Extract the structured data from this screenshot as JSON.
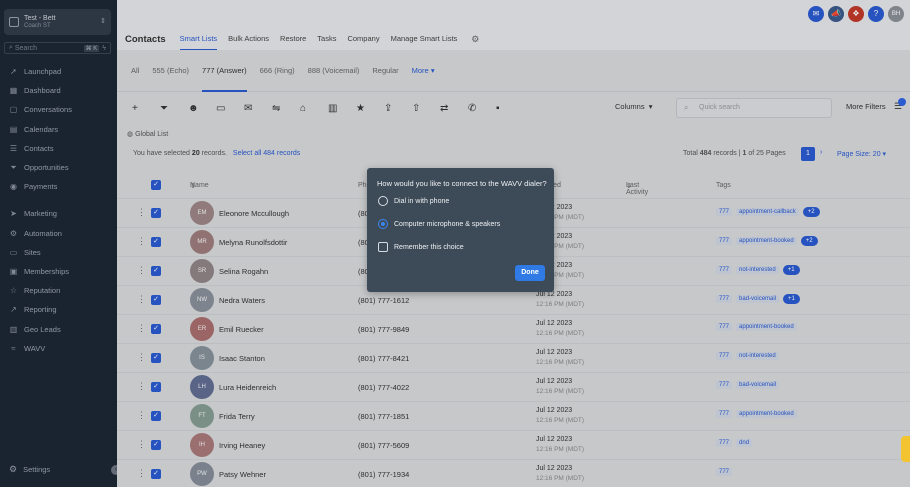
{
  "sidebar": {
    "location_name": "Test - Bett",
    "location_sub": "Coach ST",
    "search_placeholder": "Search",
    "search_shortcut": "⌘ K",
    "items": [
      {
        "label": "Launchpad",
        "icon": "rocket-icon",
        "glyph": "➚"
      },
      {
        "label": "Dashboard",
        "icon": "dashboard-icon",
        "glyph": "▦"
      },
      {
        "label": "Conversations",
        "icon": "chat-icon",
        "glyph": "▢"
      },
      {
        "label": "Calendars",
        "icon": "calendar-icon",
        "glyph": "▤"
      },
      {
        "label": "Contacts",
        "icon": "contacts-icon",
        "glyph": "☰"
      },
      {
        "label": "Opportunities",
        "icon": "funnel-icon",
        "glyph": "⏷"
      },
      {
        "label": "Payments",
        "icon": "payments-icon",
        "glyph": "◉"
      }
    ],
    "items2": [
      {
        "label": "Marketing",
        "icon": "send-icon",
        "glyph": "➤"
      },
      {
        "label": "Automation",
        "icon": "automation-icon",
        "glyph": "⚙"
      },
      {
        "label": "Sites",
        "icon": "sites-icon",
        "glyph": "▭"
      },
      {
        "label": "Memberships",
        "icon": "memberships-icon",
        "glyph": "▣"
      },
      {
        "label": "Reputation",
        "icon": "star-icon",
        "glyph": "☆"
      },
      {
        "label": "Reporting",
        "icon": "reporting-icon",
        "glyph": "↗"
      },
      {
        "label": "Geo Leads",
        "icon": "geo-leads-icon",
        "glyph": "▥"
      },
      {
        "label": "WAVV",
        "icon": "wavv-icon",
        "glyph": "≈"
      }
    ],
    "settings_label": "Settings"
  },
  "topbar": {
    "avatar_initials": "BH",
    "icons": [
      {
        "name": "message-icon",
        "glyph": "✉",
        "color": "#2a5bd0"
      },
      {
        "name": "megaphone-icon",
        "glyph": "📣",
        "color": "#3a5a8c"
      },
      {
        "name": "gift-icon",
        "glyph": "❖",
        "color": "#c0392b"
      },
      {
        "name": "help-icon",
        "glyph": "?",
        "color": "#2a5bd0"
      },
      {
        "name": "avatar-icon",
        "glyph": "BH",
        "color": "#8a8f96"
      }
    ]
  },
  "subnav": {
    "title": "Contacts",
    "items": [
      "Smart Lists",
      "Bulk Actions",
      "Restore",
      "Tasks",
      "Company",
      "Manage Smart Lists"
    ],
    "active": "Smart Lists"
  },
  "tabs": {
    "items": [
      "All",
      "555 (Echo)",
      "777 (Answer)",
      "666 (Ring)",
      "888 (Voicemail)",
      "Regular"
    ],
    "active": "777 (Answer)",
    "more_label": "More"
  },
  "toolbar": {
    "icons": [
      {
        "name": "add-icon",
        "glyph": "+"
      },
      {
        "name": "filter-icon",
        "glyph": "⏷"
      },
      {
        "name": "robot-icon",
        "glyph": "☻"
      },
      {
        "name": "sms-icon",
        "glyph": "▭"
      },
      {
        "name": "email-icon",
        "glyph": "✉"
      },
      {
        "name": "call-merge-icon",
        "glyph": "⇋"
      },
      {
        "name": "tag-add-icon",
        "glyph": "⌂"
      },
      {
        "name": "delete-icon",
        "glyph": "▥"
      },
      {
        "name": "star-icon",
        "glyph": "★"
      },
      {
        "name": "upload-icon",
        "glyph": "⇪"
      },
      {
        "name": "export-icon",
        "glyph": "⇧"
      },
      {
        "name": "dialer-icon",
        "glyph": "⇄"
      },
      {
        "name": "phone-icon",
        "glyph": "✆"
      },
      {
        "name": "message-square-icon",
        "glyph": "▪"
      }
    ],
    "columns_label": "Columns",
    "search_placeholder": "Quick search",
    "more_filters_label": "More Filters"
  },
  "list_name": "Global List",
  "selection": {
    "selected_prefix": "You have selected",
    "selected_count": "20",
    "selected_suffix": "records.",
    "select_all": "Select all 484 records",
    "total_prefix": "Total",
    "total_count": "484",
    "total_suffix": "records |",
    "page_range": "1",
    "page_of": "of 25 Pages",
    "current_page": "1",
    "page_size": "Page Size: 20"
  },
  "table": {
    "headers": {
      "name": "Name",
      "phone": "Phone",
      "created": "Created",
      "last_activity": "Last Activity",
      "tags": "Tags"
    },
    "rows": [
      {
        "initials": "EM",
        "name": "Eleonore Mccullough",
        "phone": "(801) 777-",
        "date": "Jul 12 2023",
        "time": "12:16 PM (MDT)",
        "color": "#8a6a6a",
        "tags": [
          "777",
          "appointment-callback"
        ],
        "pill": "+2"
      },
      {
        "initials": "MR",
        "name": "Melyna Runolfsdottir",
        "phone": "(801) 777-",
        "date": "Jul 12 2023",
        "time": "12:16 PM (MDT)",
        "color": "#8b5e5e",
        "tags": [
          "777",
          "appointment-booked"
        ],
        "pill": "+2"
      },
      {
        "initials": "SR",
        "name": "Selina Rogahn",
        "phone": "(801) 777-",
        "date": "Jul 12 2023",
        "time": "12:16 PM (MDT)",
        "color": "#7a6a6a",
        "tags": [
          "777",
          "not-interested"
        ],
        "pill": "+1"
      },
      {
        "initials": "NW",
        "name": "Nedra Waters",
        "phone": "(801) 777-1612",
        "date": "Jul 12 2023",
        "time": "12:16 PM (MDT)",
        "color": "#6f7884",
        "tags": [
          "777",
          "bad-voicemail"
        ],
        "pill": "+1"
      },
      {
        "initials": "ER",
        "name": "Emil Ruecker",
        "phone": "(801) 777-9849",
        "date": "Jul 12 2023",
        "time": "12:16 PM (MDT)",
        "color": "#9a4a4a",
        "tags": [
          "777",
          "appointment-booked"
        ],
        "pill": ""
      },
      {
        "initials": "IS",
        "name": "Isaac Stanton",
        "phone": "(801) 777-8421",
        "date": "Jul 12 2023",
        "time": "12:16 PM (MDT)",
        "color": "#6b7a86",
        "tags": [
          "777",
          "not-interested"
        ],
        "pill": ""
      },
      {
        "initials": "LH",
        "name": "Lura Heidenreich",
        "phone": "(801) 777-4022",
        "date": "Jul 12 2023",
        "time": "12:16 PM (MDT)",
        "color": "#3a4a7a",
        "tags": [
          "777",
          "bad-voicemail"
        ],
        "pill": ""
      },
      {
        "initials": "FT",
        "name": "Frida Terry",
        "phone": "(801) 777-1851",
        "date": "Jul 12 2023",
        "time": "12:16 PM (MDT)",
        "color": "#6a8a7a",
        "tags": [
          "777",
          "appointment-booked"
        ],
        "pill": ""
      },
      {
        "initials": "IH",
        "name": "Irving Heaney",
        "phone": "(801) 777-5609",
        "date": "Jul 12 2023",
        "time": "12:16 PM (MDT)",
        "color": "#9a5a5a",
        "tags": [
          "777",
          "dnd"
        ],
        "pill": ""
      },
      {
        "initials": "PW",
        "name": "Patsy Wehner",
        "phone": "(801) 777-1934",
        "date": "Jul 12 2023",
        "time": "12:16 PM (MDT)",
        "color": "#6a7482",
        "tags": [
          "777"
        ],
        "pill": ""
      }
    ]
  },
  "modal": {
    "question": "How would you like to connect to the WAVV dialer?",
    "option1": "Dial in with phone",
    "option2": "Computer microphone & speakers",
    "checkbox": "Remember this choice",
    "done": "Done"
  }
}
